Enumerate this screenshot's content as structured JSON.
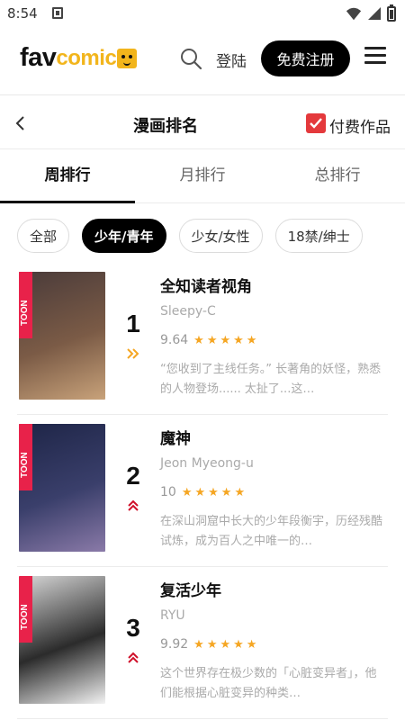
{
  "status_bar": {
    "time": "8:54"
  },
  "header": {
    "logo_fav": "fav",
    "logo_comic": "comic",
    "login_label": "登陆",
    "signup_label": "免费注册"
  },
  "subheader": {
    "title": "漫画排名",
    "paid_label": "付费作品",
    "paid_checked": true
  },
  "tabs": [
    {
      "label": "周排行",
      "active": true
    },
    {
      "label": "月排行",
      "active": false
    },
    {
      "label": "总排行",
      "active": false
    }
  ],
  "categories": [
    {
      "label": "全部",
      "active": false
    },
    {
      "label": "少年/青年",
      "active": true
    },
    {
      "label": "少女/女性",
      "active": false
    },
    {
      "label": "18禁/绅士",
      "active": false
    }
  ],
  "rankings": [
    {
      "rank": "1",
      "trend": "up-double-right",
      "title": "全知读者视角",
      "author": "Sleepy-C",
      "score": "9.64",
      "stars": "★★★★★",
      "description": "“您收到了主线任务。” 长著角的妖怪，熟悉的人物登场...... 太扯了...这…",
      "cover_tag": "TOON",
      "cover_colors": [
        "#4a3b3a",
        "#7b5b46",
        "#c8a27a"
      ]
    },
    {
      "rank": "2",
      "trend": "up",
      "title": "魔神",
      "author": "Jeon Myeong-u",
      "score": "10",
      "stars": "★★★★★",
      "description": "在深山洞窟中长大的少年段衡宇，历经残酷试炼，成为百人之中唯一的…",
      "cover_tag": "TOON",
      "cover_colors": [
        "#1e2547",
        "#3a3f6b",
        "#8a7aa8"
      ]
    },
    {
      "rank": "3",
      "trend": "up",
      "title": "复活少年",
      "author": "RYU",
      "score": "9.92",
      "stars": "★★★★★",
      "description": "这个世界存在极少数的「心脏变异者」，他们能根据心脏变异的种类…",
      "cover_tag": "TOON",
      "cover_colors": [
        "#d8d8d8",
        "#2b2b2b",
        "#f3f3f3"
      ]
    }
  ]
}
